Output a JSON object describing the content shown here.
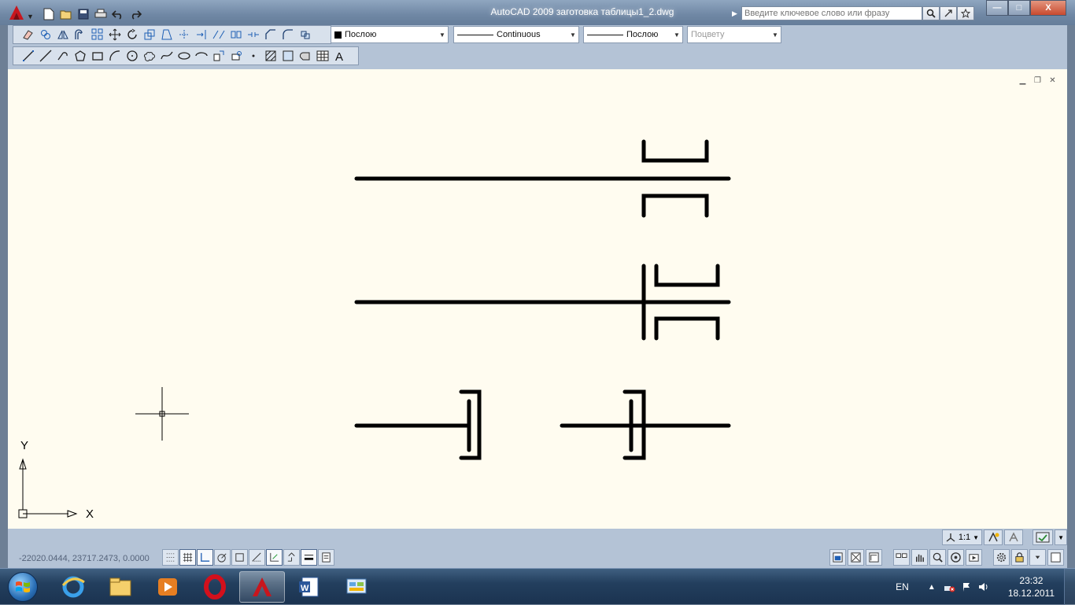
{
  "window": {
    "title": "AutoCAD 2009 заготовка таблицы1_2.dwg",
    "app_menu_icon": "autocad-logo-icon",
    "quick_access": [
      "new-icon",
      "open-icon",
      "save-icon",
      "plot-icon",
      "undo-icon",
      "redo-icon"
    ],
    "search_placeholder": "Введите ключевое слово или фразу",
    "controls": {
      "minimize": "—",
      "maximize": "□",
      "close": "X"
    }
  },
  "properties": {
    "layer": "Послою",
    "linetype": "Continuous",
    "lineweight": "Послою",
    "plotstyle": "Поцвету"
  },
  "toolbars": {
    "modify": [
      "erase-icon",
      "copy-icon",
      "mirror-icon",
      "offset-icon",
      "array-icon",
      "move-icon",
      "rotate-icon",
      "scale-icon",
      "stretch-icon",
      "trim-icon",
      "extend-icon",
      "break-at-point-icon",
      "break-icon",
      "join-icon",
      "chamfer-icon",
      "fillet-icon",
      "explode-icon"
    ],
    "draw": [
      "line-icon",
      "construction-line-icon",
      "polyline-icon",
      "polygon-icon",
      "rectangle-icon",
      "arc-icon",
      "circle-icon",
      "revision-cloud-icon",
      "spline-icon",
      "ellipse-icon",
      "ellipse-arc-icon",
      "insert-block-icon",
      "make-block-icon",
      "point-icon",
      "hatch-icon",
      "gradient-icon",
      "region-icon",
      "table-icon",
      "multiline-text-icon"
    ]
  },
  "drawing": {
    "ucs_x_label": "X",
    "ucs_y_label": "Y",
    "stroke_color": "#000000",
    "background_color": "#fffcf0"
  },
  "annotation": {
    "scale": "1:1",
    "buttons": [
      "annotation-scale-icon",
      "annotation-visibility-icon",
      "auto-add-scales-icon",
      "workspace-icon"
    ]
  },
  "status": {
    "coordinates": "-22020.0444, 23717.2473, 0.0000",
    "drafting": [
      "snap-icon",
      "grid-icon",
      "ortho-icon",
      "polar-icon",
      "osnap-icon",
      "otrack-icon",
      "ducs-icon",
      "dyn-icon",
      "lineweight-icon",
      "qp-icon"
    ],
    "drafting_on": [
      false,
      true,
      true,
      false,
      false,
      false,
      true,
      false,
      true,
      false
    ],
    "right": [
      "model-icon",
      "layout1-icon",
      "layout2-icon",
      "quick-view-icon",
      "pan-icon",
      "zoom-icon",
      "steering-wheel-icon",
      "showmotion-icon",
      "settings-icon",
      "lock-icon",
      "menu-arrow-icon",
      "clean-screen-icon"
    ]
  },
  "taskbar": {
    "start": "windows-start-icon",
    "items": [
      "internet-explorer-icon",
      "windows-explorer-icon",
      "media-player-icon",
      "opera-icon",
      "autocad-icon",
      "word-icon",
      "control-panel-icon"
    ],
    "active_item": "autocad-icon",
    "language": "EN",
    "tray_icons": [
      "tray-arrow-icon",
      "network-icon",
      "action-center-icon",
      "volume-icon"
    ],
    "time": "23:32",
    "date": "18.12.2011"
  }
}
